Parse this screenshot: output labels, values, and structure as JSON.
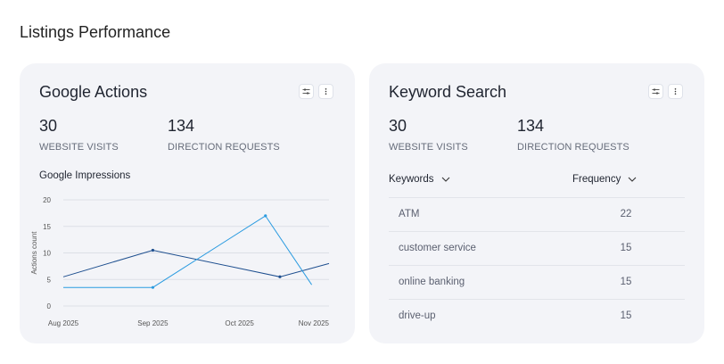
{
  "page": {
    "title": "Listings Performance"
  },
  "google_actions": {
    "title": "Google Actions",
    "icons": [
      "sliders-icon",
      "more-vertical-icon"
    ],
    "stats": [
      {
        "value": "30",
        "label": "WEBSITE VISITS"
      },
      {
        "value": "134",
        "label": "DIRECTION REQUESTS"
      }
    ],
    "chart_title": "Google Impressions",
    "chart_data": {
      "type": "line",
      "title": "Google Impressions",
      "ylabel": "Actions count",
      "xlabel": "",
      "ylim": [
        0,
        20
      ],
      "yticks": [
        "0",
        "5",
        "10",
        "15",
        "20"
      ],
      "x_tick_labels": [
        "Aug 2025",
        "Sep 2025",
        "Oct 2025",
        "Nov 2025"
      ],
      "grid": true,
      "series": [
        {
          "color": "#1e4f8f",
          "points": [
            {
              "x": "2025-08-01",
              "y": 5.5
            },
            {
              "x": "2025-09-01",
              "y": 10.5
            },
            {
              "x": "2025-10-15",
              "y": 5.5
            },
            {
              "x": "2025-11-01",
              "y": 8
            }
          ]
        },
        {
          "color": "#2b9be0",
          "points": [
            {
              "x": "2025-08-01",
              "y": 3.5
            },
            {
              "x": "2025-09-01",
              "y": 3.5
            },
            {
              "x": "2025-10-10",
              "y": 17
            },
            {
              "x": "2025-10-26",
              "y": 4
            }
          ]
        }
      ]
    }
  },
  "keyword_search": {
    "title": "Keyword Search",
    "icons": [
      "sliders-icon",
      "more-vertical-icon"
    ],
    "stats": [
      {
        "value": "30",
        "label": "WEBSITE VISITS"
      },
      {
        "value": "134",
        "label": "DIRECTION REQUESTS"
      }
    ],
    "columns": [
      "Keywords",
      "Frequency"
    ],
    "rows": [
      {
        "keyword": "ATM",
        "frequency": "22"
      },
      {
        "keyword": "customer service",
        "frequency": "15"
      },
      {
        "keyword": "online banking",
        "frequency": "15"
      },
      {
        "keyword": "drive-up",
        "frequency": "15"
      }
    ]
  }
}
